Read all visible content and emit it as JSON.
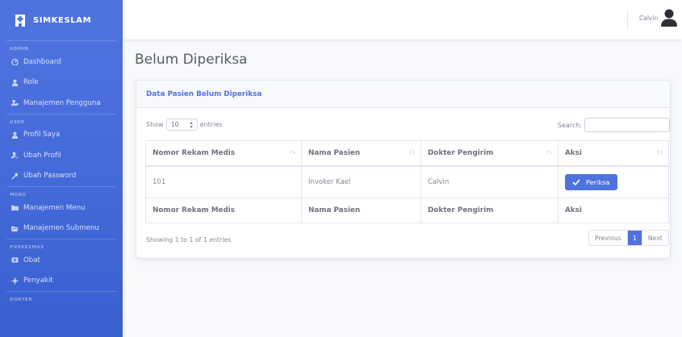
{
  "brand": {
    "name": "SIMKESLAM",
    "icon": "hospital-icon"
  },
  "sidebar": {
    "sections": [
      {
        "heading": "ADMIN",
        "items": [
          {
            "label": "Dashboard",
            "icon": "dashboard-icon"
          },
          {
            "label": "Role",
            "icon": "user-tie-icon"
          },
          {
            "label": "Manajemen Pengguna",
            "icon": "users-cog-icon"
          }
        ]
      },
      {
        "heading": "USER",
        "items": [
          {
            "label": "Profil Saya",
            "icon": "user-icon"
          },
          {
            "label": "Ubah Profil",
            "icon": "user-edit-icon"
          },
          {
            "label": "Ubah Password",
            "icon": "key-icon"
          }
        ]
      },
      {
        "heading": "MENU",
        "items": [
          {
            "label": "Manajemen Menu",
            "icon": "folder-icon"
          },
          {
            "label": "Manajemen Submenu",
            "icon": "folder-open-icon"
          }
        ]
      },
      {
        "heading": "PUSKESMAS",
        "items": [
          {
            "label": "Obat",
            "icon": "pills-icon"
          },
          {
            "label": "Penyakit",
            "icon": "virus-icon"
          }
        ]
      },
      {
        "heading": "DOKTER",
        "items": []
      }
    ]
  },
  "topbar": {
    "user_name": "Calvin",
    "user_icon": "user-avatar-icon"
  },
  "page": {
    "title": "Belum Diperiksa"
  },
  "card": {
    "title": "Data Pasien Belum Diperiksa",
    "length_prefix": "Show",
    "length_value": "10",
    "length_suffix": "entries",
    "search_label": "Search:",
    "search_value": "",
    "columns": [
      "Nomor Rekam Medis",
      "Nama Pasien",
      "Dokter Pengirim",
      "Aksi"
    ],
    "rows": [
      {
        "no_rm": "101",
        "nama": "Invoker Kael",
        "dokter": "Calvin",
        "aksi": "Periksa"
      }
    ],
    "info": "Showing 1 to 1 of 1 entries",
    "pagination": {
      "previous": "Previous",
      "current": "1",
      "next": "Next"
    }
  },
  "colors": {
    "primary": "#4e73df",
    "text": "#858796",
    "border": "#e3e6f0"
  }
}
